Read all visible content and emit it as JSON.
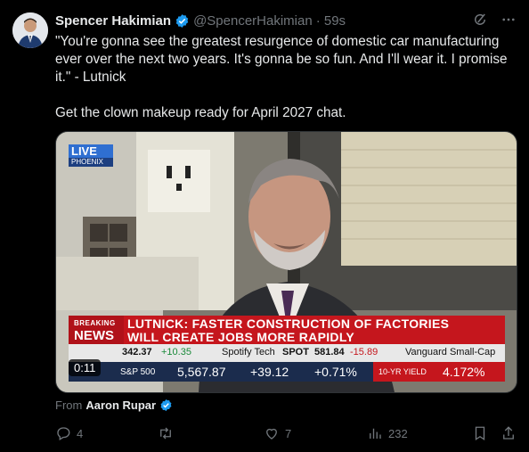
{
  "tweet": {
    "author_name": "Spencer Hakimian",
    "author_handle": "@SpencerHakimian",
    "time": "· 59s",
    "text": "\"You're gonna see the greatest resurgence of domestic car manufacturing ever over the next two years. It's gonna be so fun. And I'll wear it. I promise it.\" - Lutnick\n\nGet the clown makeup ready for April 2027 chat.",
    "from_label": "From",
    "from_name": "Aaron Rupar"
  },
  "video": {
    "live_label": "LIVE",
    "live_location": "PHOENIX",
    "breaking_label": "BREAKING",
    "news_label": "NEWS",
    "headline_line1": "LUTNICK: FASTER CONSTRUCTION OF FACTORIES",
    "headline_line2": "WILL CREATE JOBS MORE RAPIDLY",
    "ticker_top": {
      "item1_value": "342.37",
      "item1_change": "+10.35",
      "item2_name": "Spotify Tech",
      "item2_sym": "SPOT",
      "item2_value": "581.84",
      "item2_change": "-15.89",
      "item3_name": "Vanguard Small-Cap"
    },
    "ticker_bottom": {
      "index_name": "S&P 500",
      "index_value": "5,567.87",
      "index_change": "+39.12",
      "index_pct": "+0.71%",
      "yield_label": "10-YR YIELD",
      "yield_value": "4.172%"
    },
    "duration": "0:11"
  },
  "actions": {
    "replies": "4",
    "reposts": "",
    "likes": "7",
    "views": "232"
  },
  "colors": {
    "background": "#000000",
    "text": "#e7e9ea",
    "muted": "#71767b",
    "verified": "#1d9bf0",
    "cnbc_red": "#c5161d",
    "cnbc_navy": "#1b2c4d"
  }
}
